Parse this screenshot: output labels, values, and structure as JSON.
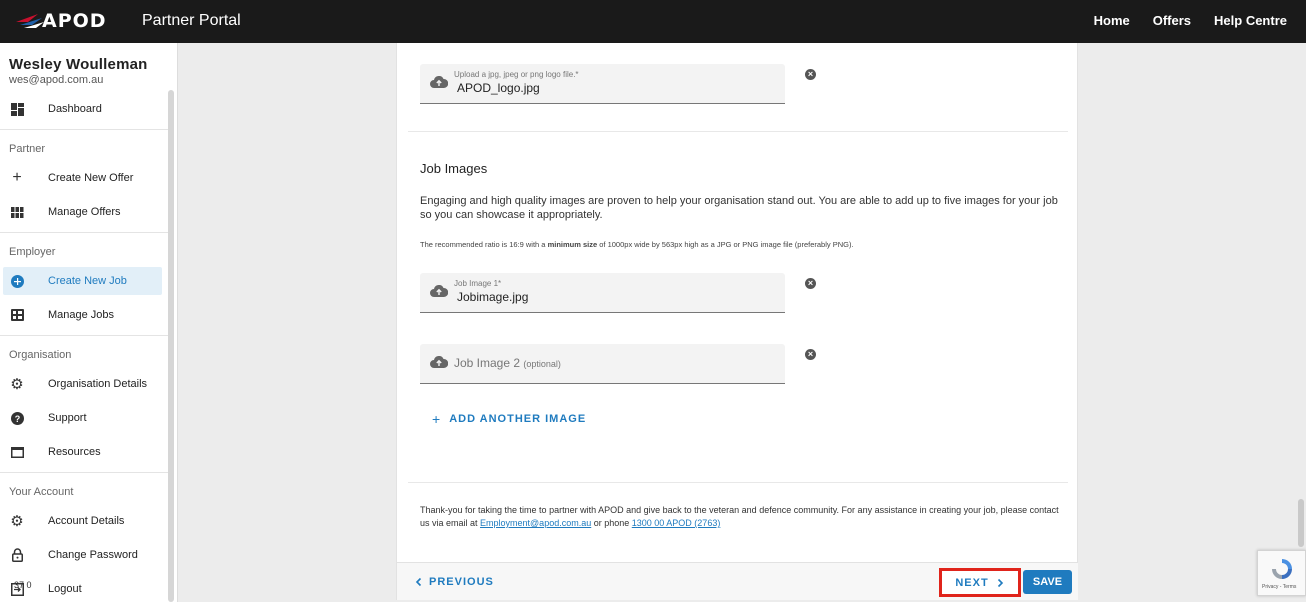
{
  "header": {
    "logo_text": "APOD",
    "portal_title": "Partner Portal",
    "nav": [
      "Home",
      "Offers",
      "Help Centre"
    ]
  },
  "sidebar": {
    "user_name": "Wesley Woulleman",
    "user_email": "wes@apod.com.au",
    "dashboard": "Dashboard",
    "partner_label": "Partner",
    "create_offer": "Create New Offer",
    "manage_offers": "Manage Offers",
    "employer_label": "Employer",
    "create_job": "Create New Job",
    "manage_jobs": "Manage Jobs",
    "organisation_label": "Organisation",
    "org_details": "Organisation Details",
    "support": "Support",
    "resources": "Resources",
    "account_label": "Your Account",
    "account_details": "Account Details",
    "change_password": "Change Password",
    "logout": "Logout",
    "stub_text": "37 0"
  },
  "logo_upload": {
    "label": "Upload a jpg, jpeg or png logo file.*",
    "value": "APOD_logo.jpg"
  },
  "job_images": {
    "heading": "Job Images",
    "description": "Engaging and high quality images are proven to help your organisation stand out. You are able to add up to five images for your job so you can showcase it appropriately.",
    "note_prefix": "The recommended ratio is 16:9 with a ",
    "note_bold": "minimum size",
    "note_suffix": " of 1000px wide by 563px high as a JPG or PNG image file (preferably PNG).",
    "image1_label": "Job Image 1*",
    "image1_value": "Jobimage.jpg",
    "image2_label": "Job Image 2",
    "image2_optional": "(optional)",
    "add_another": "ADD ANOTHER IMAGE"
  },
  "thanks": {
    "text_before": "Thank-you for taking the time to partner with APOD and give back to the veteran and defence community. For any assistance in creating your job, please contact us via email at ",
    "email": "Employment@apod.com.au",
    "text_mid": " or phone ",
    "phone": "1300 00 APOD (2763)"
  },
  "footer": {
    "previous": "PREVIOUS",
    "next": "NEXT",
    "save": "SAVE"
  },
  "recaptcha": {
    "privacy": "Privacy - Terms"
  },
  "colors": {
    "accent": "#1f7bbf",
    "highlight_border": "#e0241b",
    "topbar": "#1a1a1a"
  }
}
